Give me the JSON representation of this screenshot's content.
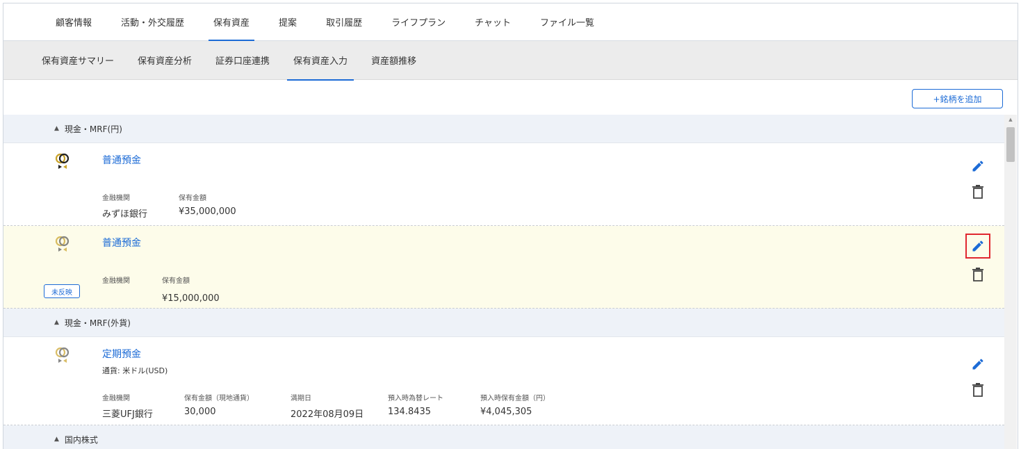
{
  "top_tabs": [
    "顧客情報",
    "活動・外交履歴",
    "保有資産",
    "提案",
    "取引履歴",
    "ライフプラン",
    "チャット",
    "ファイル一覧"
  ],
  "top_active_index": 2,
  "sub_tabs": [
    "保有資産サマリー",
    "保有資産分析",
    "証券口座連携",
    "保有資産入力",
    "資産額推移"
  ],
  "sub_active_index": 3,
  "add_button_label": "+銘柄を追加",
  "sections": {
    "cash_jpy": "現金・MRF(円)",
    "cash_fx": "現金・MRF(外貨)",
    "domestic_stock": "国内株式"
  },
  "items": [
    {
      "name": "普通預金",
      "fields": [
        {
          "label": "金融機関",
          "value": "みずほ銀行"
        },
        {
          "label": "保有金額",
          "value": "¥35,000,000"
        }
      ]
    },
    {
      "name": "普通預金",
      "badge": "未反映",
      "fields": [
        {
          "label": "金融機関",
          "value": ""
        },
        {
          "label": "保有金額",
          "value": "¥15,000,000"
        }
      ]
    },
    {
      "name": "定期預金",
      "currency": "通貨: 米ドル(USD)",
      "fields": [
        {
          "label": "金融機関",
          "value": "三菱UFJ銀行"
        },
        {
          "label": "保有金額（現地通貨）",
          "value": "30,000"
        },
        {
          "label": "満期日",
          "value": "2022年08月09日"
        },
        {
          "label": "預入時為替レート",
          "value": "134.8435"
        },
        {
          "label": "預入時保有金額（円）",
          "value": "¥4,045,305"
        }
      ]
    }
  ],
  "colors": {
    "accent": "#1c6bd6",
    "highlight_row": "#fdfcea",
    "section_bg": "#eef2f8",
    "subtab_bg": "#ececec",
    "focus_box": "#e0262f"
  },
  "icons": {
    "asset": "rings-icon",
    "edit": "pencil-icon",
    "delete": "trash-icon",
    "expand": "triangle-up-icon"
  }
}
